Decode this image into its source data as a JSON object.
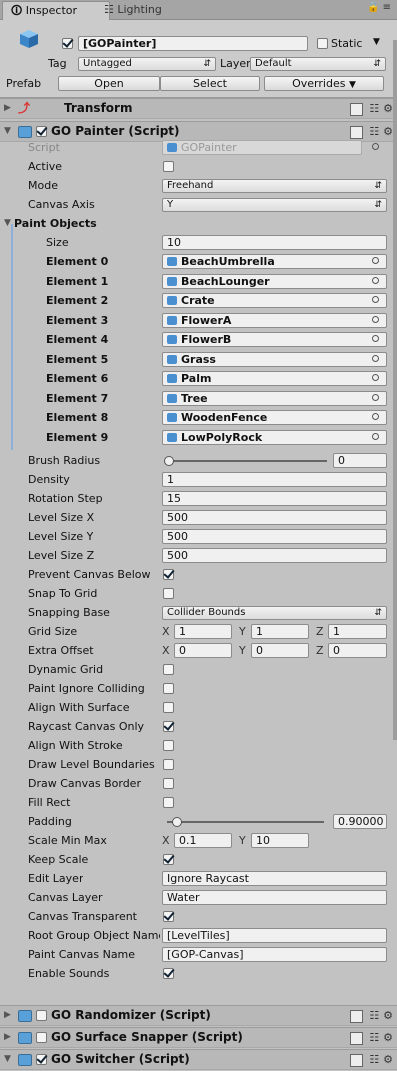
{
  "tabs": {
    "inspector": "Inspector",
    "lighting": "Lighting"
  },
  "gameobject": {
    "name": "[GOPainter]",
    "static_label": "Static",
    "tag_label": "Tag",
    "tag_value": "Untagged",
    "layer_label": "Layer",
    "layer_value": "Default",
    "prefab_label": "Prefab",
    "open": "Open",
    "select": "Select",
    "overrides": "Overrides"
  },
  "transform": {
    "title": "Transform"
  },
  "painter": {
    "title": "GO Painter (Script)",
    "script_label": "Script",
    "script_value": "GOPainter",
    "active_label": "Active",
    "mode_label": "Mode",
    "mode_value": "Freehand",
    "canvas_axis_label": "Canvas Axis",
    "canvas_axis_value": "Y",
    "paint_objects_label": "Paint Objects",
    "size_label": "Size",
    "size_value": "10",
    "elements": [
      {
        "label": "Element 0",
        "value": "BeachUmbrella"
      },
      {
        "label": "Element 1",
        "value": "BeachLounger"
      },
      {
        "label": "Element 2",
        "value": "Crate"
      },
      {
        "label": "Element 3",
        "value": "FlowerA"
      },
      {
        "label": "Element 4",
        "value": "FlowerB"
      },
      {
        "label": "Element 5",
        "value": "Grass"
      },
      {
        "label": "Element 6",
        "value": "Palm"
      },
      {
        "label": "Element 7",
        "value": "Tree"
      },
      {
        "label": "Element 8",
        "value": "WoodenFence"
      },
      {
        "label": "Element 9",
        "value": "LowPolyRock"
      }
    ],
    "brush_radius_label": "Brush Radius",
    "brush_radius_value": "0",
    "density_label": "Density",
    "density_value": "1",
    "rotation_step_label": "Rotation Step",
    "rotation_step_value": "15",
    "level_x_label": "Level Size X",
    "level_x_value": "500",
    "level_y_label": "Level Size Y",
    "level_y_value": "500",
    "level_z_label": "Level Size Z",
    "level_z_value": "500",
    "prevent_canvas_label": "Prevent Canvas Below",
    "snap_grid_label": "Snap To Grid",
    "snapping_base_label": "Snapping Base",
    "snapping_base_value": "Collider Bounds",
    "grid_size_label": "Grid Size",
    "grid_size": {
      "x": "1",
      "y": "1",
      "z": "1"
    },
    "extra_offset_label": "Extra Offset",
    "extra_offset": {
      "x": "0",
      "y": "0",
      "z": "0"
    },
    "axis_x": "X",
    "axis_y": "Y",
    "axis_z": "Z",
    "dynamic_grid_label": "Dynamic Grid",
    "paint_ignore_label": "Paint Ignore Colliding",
    "align_surface_label": "Align With Surface",
    "raycast_canvas_label": "Raycast Canvas Only",
    "align_stroke_label": "Align With Stroke",
    "draw_level_label": "Draw Level Boundaries",
    "draw_canvas_label": "Draw Canvas Border",
    "fill_rect_label": "Fill Rect",
    "padding_label": "Padding",
    "padding_value": "0.90000",
    "scale_minmax_label": "Scale Min Max",
    "scale_min": "0.1",
    "scale_max": "10",
    "keep_scale_label": "Keep Scale",
    "edit_layer_label": "Edit Layer",
    "edit_layer_value": "Ignore Raycast",
    "canvas_layer_label": "Canvas Layer",
    "canvas_layer_value": "Water",
    "canvas_transparent_label": "Canvas Transparent",
    "root_group_label": "Root Group Object Name",
    "root_group_value": "[LevelTiles]",
    "paint_canvas_label": "Paint Canvas Name",
    "paint_canvas_value": "[GOP-Canvas]",
    "enable_sounds_label": "Enable Sounds"
  },
  "components": {
    "randomizer": "GO Randomizer (Script)",
    "surface_snapper": "GO Surface Snapper (Script)",
    "switcher": "GO Switcher (Script)"
  }
}
